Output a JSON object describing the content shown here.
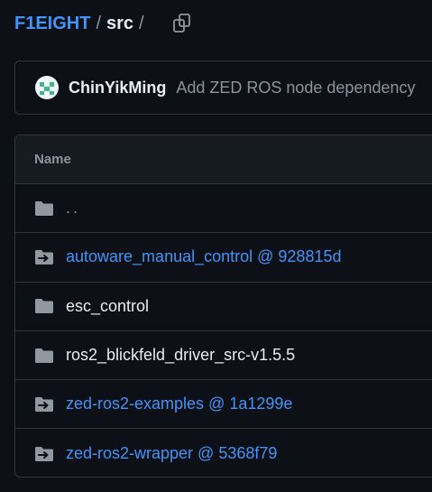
{
  "breadcrumb": {
    "repo": "F1EIGHT",
    "sep1": "/",
    "dir": "src",
    "sep2": "/"
  },
  "commit": {
    "author": "ChinYikMing",
    "message": "Add ZED ROS node dependency"
  },
  "table": {
    "header": "Name",
    "rows": [
      {
        "label": "..",
        "kind": "parent",
        "icon": "folder-icon"
      },
      {
        "label": "autoware_manual_control @ 928815d",
        "kind": "submodule",
        "icon": "submodule-folder-icon"
      },
      {
        "label": "esc_control",
        "kind": "dir",
        "icon": "folder-icon"
      },
      {
        "label": "ros2_blickfeld_driver_src-v1.5.5",
        "kind": "dir",
        "icon": "folder-icon"
      },
      {
        "label": "zed-ros2-examples @ 1a1299e",
        "kind": "submodule",
        "icon": "submodule-folder-icon"
      },
      {
        "label": "zed-ros2-wrapper @ 5368f79",
        "kind": "submodule",
        "icon": "submodule-folder-icon"
      }
    ]
  },
  "colors": {
    "background": "#0d1117",
    "link": "#4493f8",
    "muted": "#8b949e",
    "border": "#30363d",
    "icon": "#9198a1"
  }
}
